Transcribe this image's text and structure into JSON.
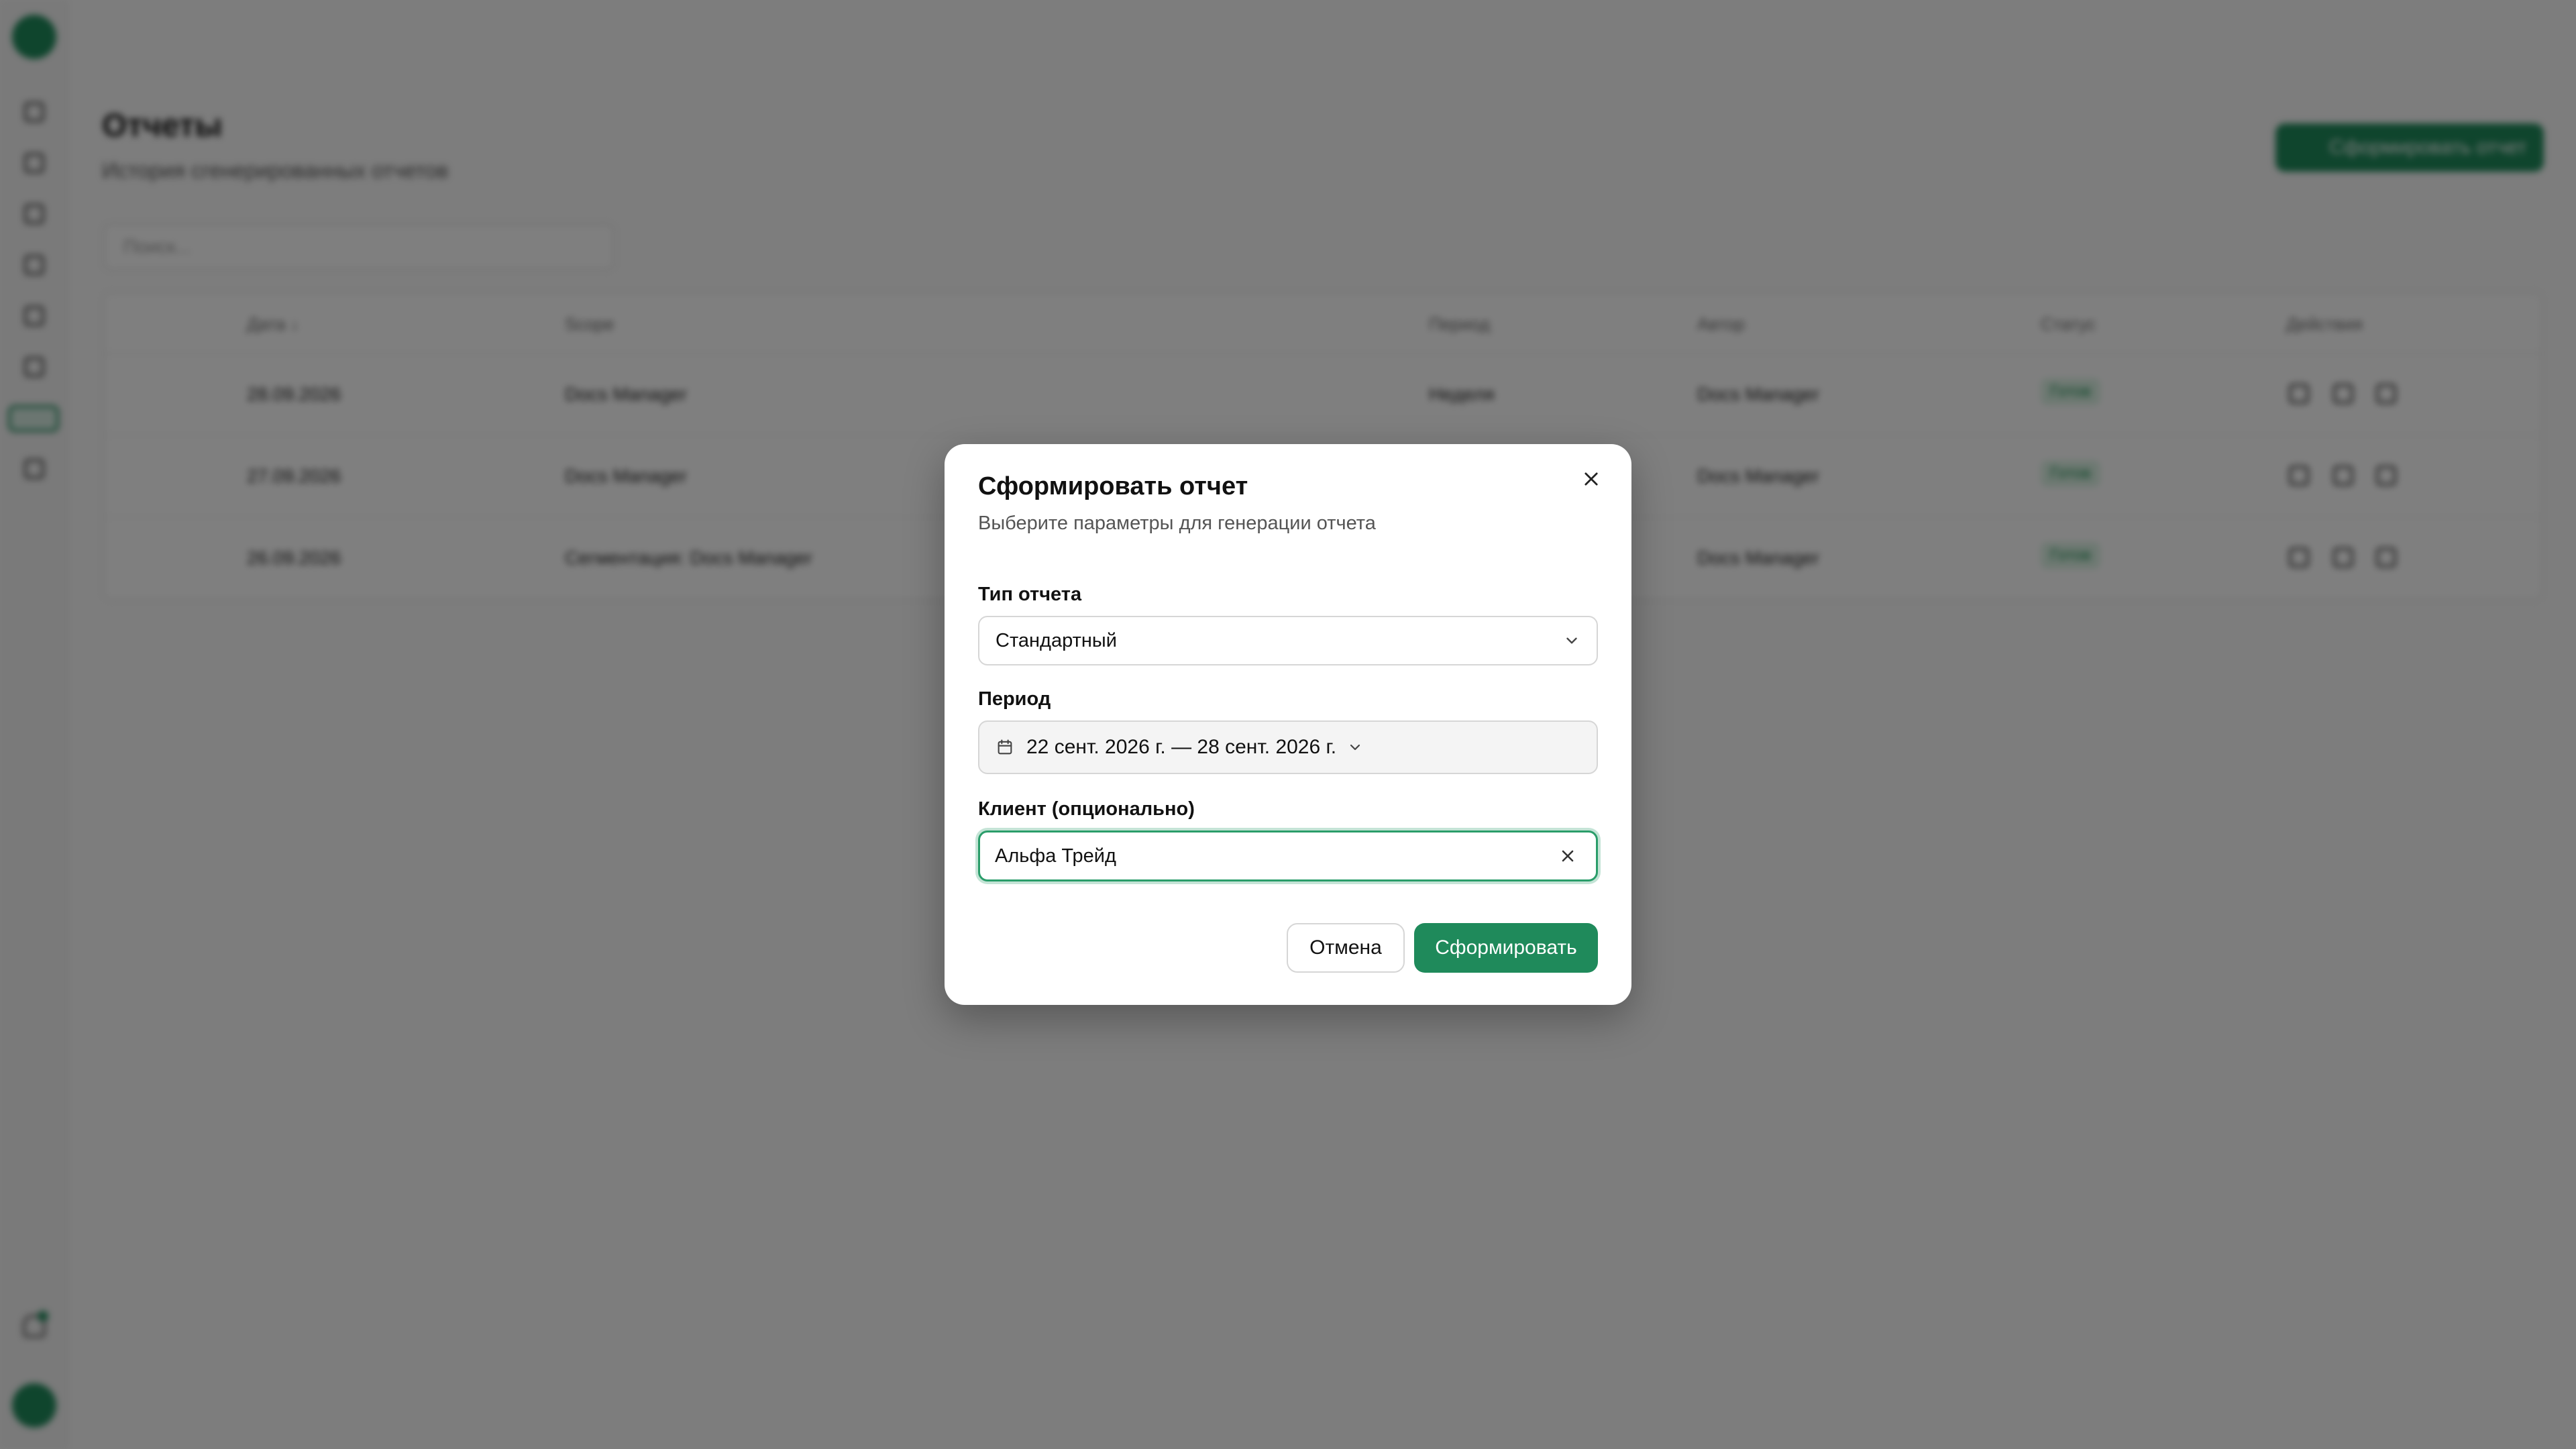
{
  "background": {
    "page_title": "Отчеты",
    "page_subtitle": "История сгенерированных отчетов",
    "new_report_button": "Сформировать отчет",
    "search_placeholder": "Поиск...",
    "table": {
      "columns": [
        "Дата ↓",
        "Scope",
        "Период",
        "Автор",
        "Статус",
        "Действия"
      ],
      "rows": [
        {
          "date": "28.09.2026",
          "scope": "Docs Manager",
          "period": "Неделя",
          "author": "Docs Manager",
          "status": "Готов"
        },
        {
          "date": "27.09.2026",
          "scope": "Docs Manager",
          "period": "",
          "author": "Docs Manager",
          "status": "Готов"
        },
        {
          "date": "26.09.2026",
          "scope": "Сегментация: Docs Manager",
          "period": "",
          "author": "Docs Manager",
          "status": "Готов"
        }
      ]
    }
  },
  "modal": {
    "title": "Сформировать отчет",
    "subtitle": "Выберите параметры для генерации отчета",
    "report_type": {
      "label": "Тип отчета",
      "value": "Стандартный"
    },
    "period": {
      "label": "Период",
      "value": "22 сент. 2026 г. — 28 сент. 2026 г."
    },
    "client": {
      "label": "Клиент (опционально)",
      "value": "Альфа Трейд"
    },
    "cancel_label": "Отмена",
    "submit_label": "Сформировать"
  },
  "colors": {
    "accent": "#1f8a5b",
    "overlay": "rgba(0,0,0,0.5)"
  }
}
